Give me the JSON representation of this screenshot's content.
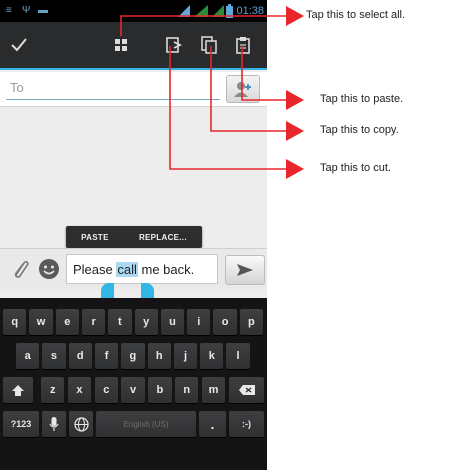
{
  "status_bar": {
    "time": "01:38"
  },
  "action_bar": {
    "buttons": [
      {
        "name": "done",
        "icon": "checkmark-icon"
      },
      {
        "name": "select-all",
        "icon": "select-all-icon"
      },
      {
        "name": "cut",
        "icon": "cut-icon"
      },
      {
        "name": "copy",
        "icon": "copy-icon"
      },
      {
        "name": "paste",
        "icon": "paste-icon"
      }
    ]
  },
  "recipient": {
    "placeholder": "To",
    "contact_icon": "contact-add-icon"
  },
  "popup_menu": {
    "paste_label": "PASTE",
    "replace_label": "REPLACE..."
  },
  "compose": {
    "text_before": "Please ",
    "text_selected": "call",
    "text_after": " me back.",
    "attach_icon": "paperclip-icon",
    "emoji_icon": "smiley-icon",
    "send_icon": "send-icon"
  },
  "keyboard": {
    "row1": [
      "q",
      "w",
      "e",
      "r",
      "t",
      "y",
      "u",
      "i",
      "o",
      "p"
    ],
    "row2": [
      "a",
      "s",
      "d",
      "f",
      "g",
      "h",
      "j",
      "k",
      "l"
    ],
    "row3": [
      "z",
      "x",
      "c",
      "v",
      "b",
      "n",
      "m"
    ],
    "symbols_label": "?123",
    "space_label": "English (US)",
    "period_label": ".",
    "smiley_label": ":-)"
  },
  "callouts": {
    "select_all": "Tap this to select all.",
    "paste": "Tap this to paste.",
    "copy": "Tap this to copy.",
    "cut": "Tap this to cut."
  },
  "colors": {
    "accent": "#33b5e5",
    "arrow": "#e8262b",
    "action_bar": "#2a2b2c"
  }
}
